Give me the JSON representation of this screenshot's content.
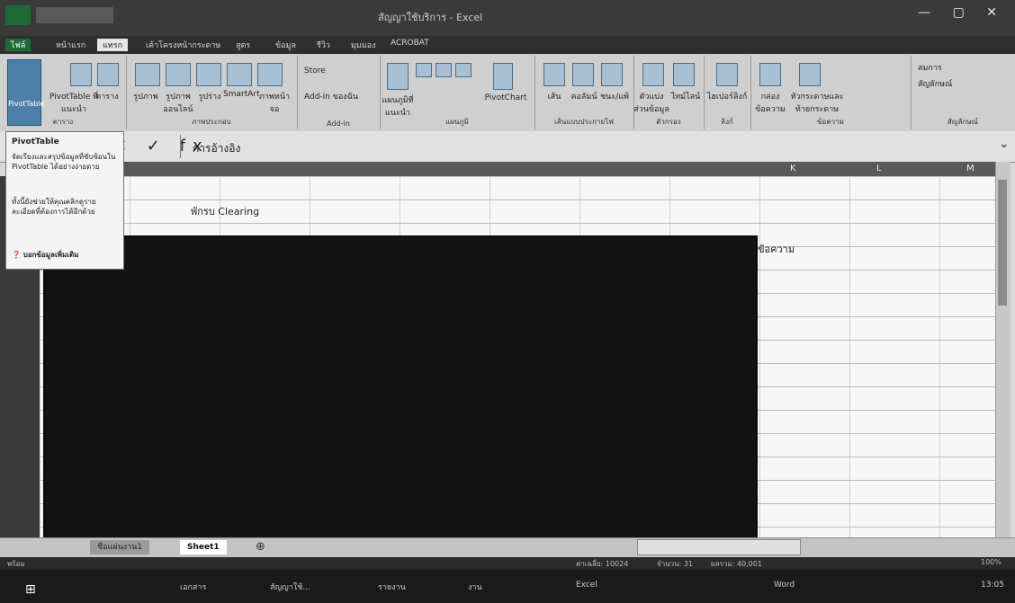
{
  "window": {
    "title": "สัญญาใช้บริการ - Excel",
    "controls": "— ▢ ✕"
  },
  "qat": {
    "file_tab": "ไฟล์"
  },
  "tabs": [
    {
      "label": "หน้าแรก"
    },
    {
      "label": "แทรก"
    },
    {
      "label": "เค้าโครงหน้ากระดาษ"
    },
    {
      "label": "สูตร"
    },
    {
      "label": "ข้อมูล"
    },
    {
      "label": "รีวิว"
    },
    {
      "label": "มุมมอง"
    },
    {
      "label": "ACROBAT"
    }
  ],
  "ribbon": {
    "pivottable": "PivotTable",
    "recommended_pivot": "PivotTable ที่แนะนำ",
    "table": "ตาราง",
    "tables_group": "ตาราง",
    "pictures": "รูปภาพ",
    "online_pictures": "รูปภาพออนไลน์",
    "shapes": "รูปร่าง",
    "smartart": "SmartArt",
    "screenshot": "ภาพหน้าจอ",
    "illustrations_group": "ภาพประกอบ",
    "store": "Store",
    "my_addins": "Add-in ของฉัน",
    "addins_group": "Add-in",
    "recommended_charts": "แผนภูมิที่แนะนำ",
    "charts_group": "แผนภูมิ",
    "pivotchart": "PivotChart",
    "line": "เส้น",
    "column": "คอลัมน์",
    "winloss": "ชนะ/แพ้",
    "sparklines_group": "เส้นแบบประกายไฟ",
    "slicer": "ตัวแบ่งส่วนข้อมูล",
    "timeline": "ไทม์ไลน์",
    "filters_group": "ตัวกรอง",
    "hyperlink": "ไฮเปอร์ลิงก์",
    "links_group": "ลิงก์",
    "textbox": "กล่องข้อความ",
    "header_footer": "หัวกระดาษและท้ายกระดาษ",
    "text_group": "ข้อความ",
    "equation": "สมการ",
    "symbol": "สัญลักษณ์",
    "symbols_group": "สัญลักษณ์"
  },
  "tooltip": {
    "title": "PivotTable",
    "line1": "จัดเรียงและสรุปข้อมูลที่ซับซ้อนใน PivotTable ได้อย่างง่ายดาย",
    "line2": "ทั้งนี้ยังช่วยให้คุณคลิกดูรายละเอียดที่ต้องการได้อีกด้วย",
    "link": "บอกข้อมูลเพิ่มเติม"
  },
  "formula_bar": {
    "icons": "✕ ✓ fx",
    "value": "การอ้างอิง"
  },
  "columns": [
    "K",
    "L",
    "M"
  ],
  "cells": {
    "a2": "พักรบ Clearing",
    "label": "ข้อความ"
  },
  "sheets": [
    {
      "label": "ชื่อแผ่นงาน1"
    },
    {
      "label": "Sheet1"
    }
  ],
  "add_sheet": "⊕",
  "status": {
    "ready": "พร้อม",
    "avg": "ค่าเฉลี่ย: 10024",
    "count": "จำนวน: 31",
    "sum": "ผลรวม: 40,001",
    "zoom": "100%"
  },
  "taskbar": {
    "start": "⊞",
    "items": [
      "เอกสาร",
      "สัญญาใช้...",
      "รายงาน",
      "งาน",
      "Excel",
      "Word"
    ],
    "clock": "13:05"
  }
}
